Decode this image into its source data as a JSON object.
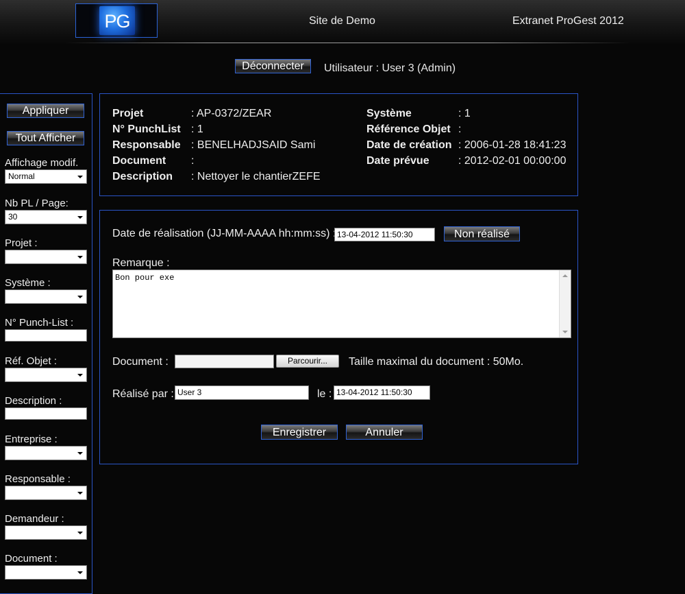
{
  "header": {
    "logo_text": "PG",
    "site_name": "Site de Demo",
    "app_title": "Extranet ProGest 2012",
    "disconnect_label": "Déconnecter",
    "user_info": "Utilisateur : User 3  (Admin)"
  },
  "sidebar": {
    "apply_label": "Appliquer",
    "show_all_label": "Tout Afficher",
    "affichage_label": "Affichage modif.",
    "affichage_value": "Normal",
    "nbpl_label": "Nb PL / Page:",
    "nbpl_value": "30",
    "projet_label": "Projet :",
    "systeme_label": "Système :",
    "punchlist_label": "N° Punch-List :",
    "refobjet_label": "Réf. Objet :",
    "description_label": "Description :",
    "entreprise_label": "Entreprise :",
    "responsable_label": "Responsable :",
    "demandeur_label": "Demandeur :",
    "document_label": "Document :"
  },
  "info": {
    "projet_label": "Projet",
    "projet_value": ": AP-0372/ZEAR",
    "punchlist_label": "N° PunchList",
    "punchlist_value": ": 1",
    "responsable_label": "Responsable",
    "responsable_value": ": BENELHADJSAID Sami",
    "document_label": "Document",
    "document_value": ":",
    "description_label": "Description",
    "description_value": ": Nettoyer le chantierZEFE",
    "systeme_label": "Système",
    "systeme_value": ": 1",
    "refobjet_label": "Référence Objet",
    "refobjet_value": ":",
    "date_creation_label": "Date de création",
    "date_creation_value": ": 2006-01-28 18:41:23",
    "date_prevue_label": "Date prévue",
    "date_prevue_value": ": 2012-02-01 00:00:00"
  },
  "form": {
    "date_label": "Date de réalisation (JJ-MM-AAAA hh:mm:ss) :",
    "date_value": "13-04-2012 11:50:30",
    "non_realise_label": "Non réalisé",
    "remarque_label": "Remarque :",
    "remarque_value": "Bon pour exe",
    "document_label": "Document :",
    "browse_label": "Parcourir...",
    "max_size_text": "Taille maximal du document : 50Mo.",
    "realise_par_label": "Réalisé par :",
    "realise_par_value": "User 3",
    "le_label": "le :",
    "le_value": "13-04-2012 11:50:30",
    "save_label": "Enregistrer",
    "cancel_label": "Annuler"
  }
}
